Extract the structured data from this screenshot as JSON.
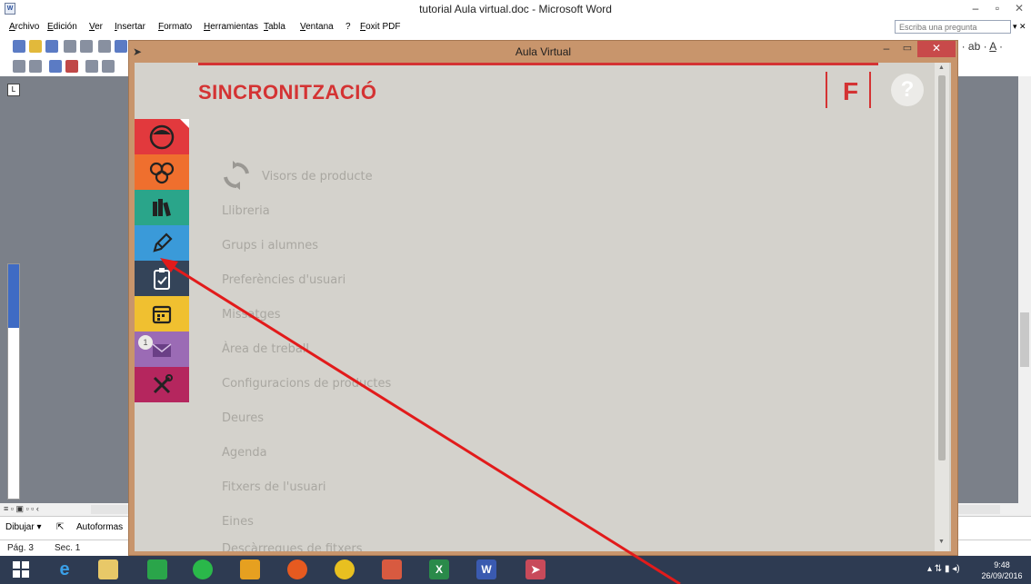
{
  "word": {
    "title": "tutorial Aula virtual.doc - Microsoft Word",
    "menu": [
      "Archivo",
      "Edición",
      "Ver",
      "Insertar",
      "Formato",
      "Herramientas",
      "Tabla",
      "Ventana",
      "?",
      "Foxit PDF"
    ],
    "ask_placeholder": "Escriba una pregunta",
    "drawing_bar": {
      "draw": "Dibujar ▾",
      "autoshapes": "Autoformas"
    },
    "status": {
      "page": "Pág. 3",
      "section": "Sec. 1"
    }
  },
  "aula": {
    "window_title": "Aula Virtual",
    "heading": "SINCRONITZACIÓ",
    "help_glyph": "?",
    "logo_glyph": "F",
    "nav_badge": "1",
    "menu_items": [
      "Visors de producte",
      "Llibreria",
      "Grups i alumnes",
      "Preferències d'usuari",
      "Missatges",
      "Àrea de treball",
      "Configuracions de productes",
      "Deures",
      "Agenda",
      "Fitxers de l'usuari",
      "Eines",
      "Descàrregues de fitxers"
    ],
    "nav_tiles": [
      {
        "icon": "user-face-icon",
        "color": "#e2393d"
      },
      {
        "icon": "group-icon",
        "color": "#ef6f2e"
      },
      {
        "icon": "library-books-icon",
        "color": "#2aa58a"
      },
      {
        "icon": "pencil-icon",
        "color": "#3a9ad9"
      },
      {
        "icon": "clipboard-check-icon",
        "color": "#344459"
      },
      {
        "icon": "calendar-icon",
        "color": "#f0c030"
      },
      {
        "icon": "envelope-icon",
        "color": "#9b6bb5"
      },
      {
        "icon": "tools-icon",
        "color": "#b5265e"
      }
    ],
    "accent_color": "#d43333"
  },
  "taskbar": {
    "time": "9:48",
    "date": "26/09/2016"
  }
}
